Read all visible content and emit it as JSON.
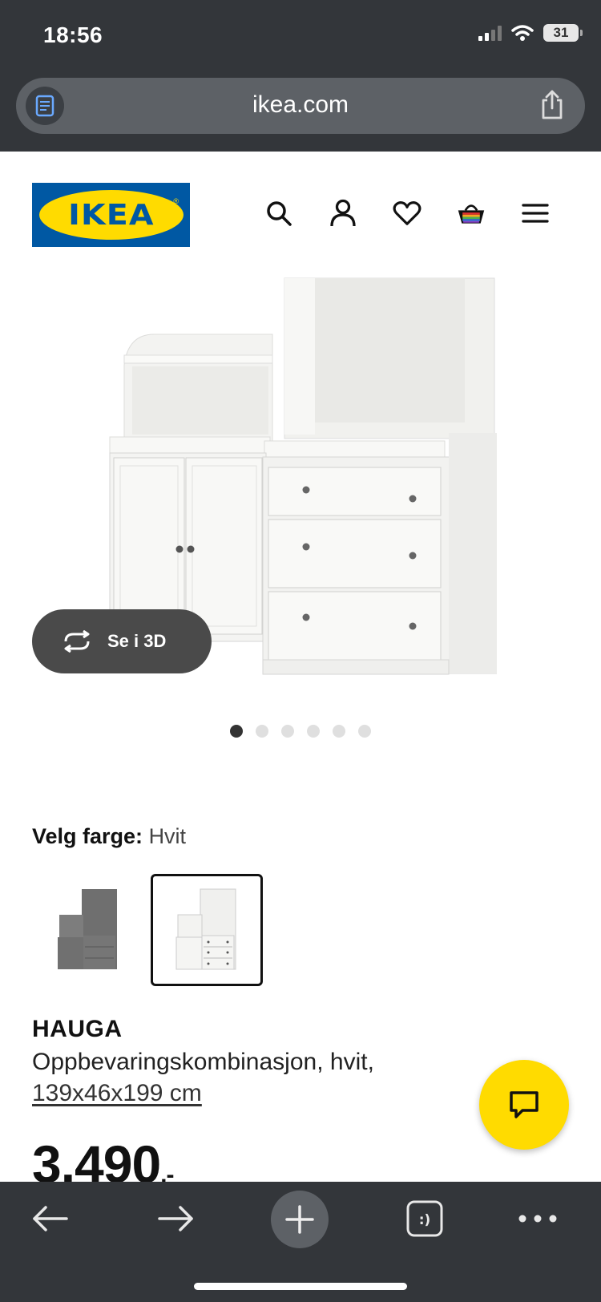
{
  "status_bar": {
    "time": "18:56",
    "battery": "31"
  },
  "browser": {
    "url": "ikea.com",
    "page_icon": "reader-icon",
    "share_icon": "share-icon"
  },
  "header": {
    "logo_text": "IKEA",
    "icons": [
      "search-icon",
      "user-icon",
      "heart-icon",
      "basket-icon",
      "menu-icon"
    ]
  },
  "gallery": {
    "view_3d_label": "Se i 3D",
    "dot_count": 6,
    "active_dot": 0
  },
  "color": {
    "label": "Velg farge:",
    "value": "Hvit",
    "options": [
      "Grå",
      "Hvit"
    ],
    "selected": 1
  },
  "product": {
    "name": "HAUGA",
    "description": "Oppbevaringskombinasjon, hvit,",
    "size": "139x46x199 cm",
    "price": "3.490",
    "price_suffix": ",-"
  },
  "colors": {
    "brand_blue": "#0058a3",
    "brand_yellow": "#ffdb00",
    "chrome": "#33363a"
  }
}
